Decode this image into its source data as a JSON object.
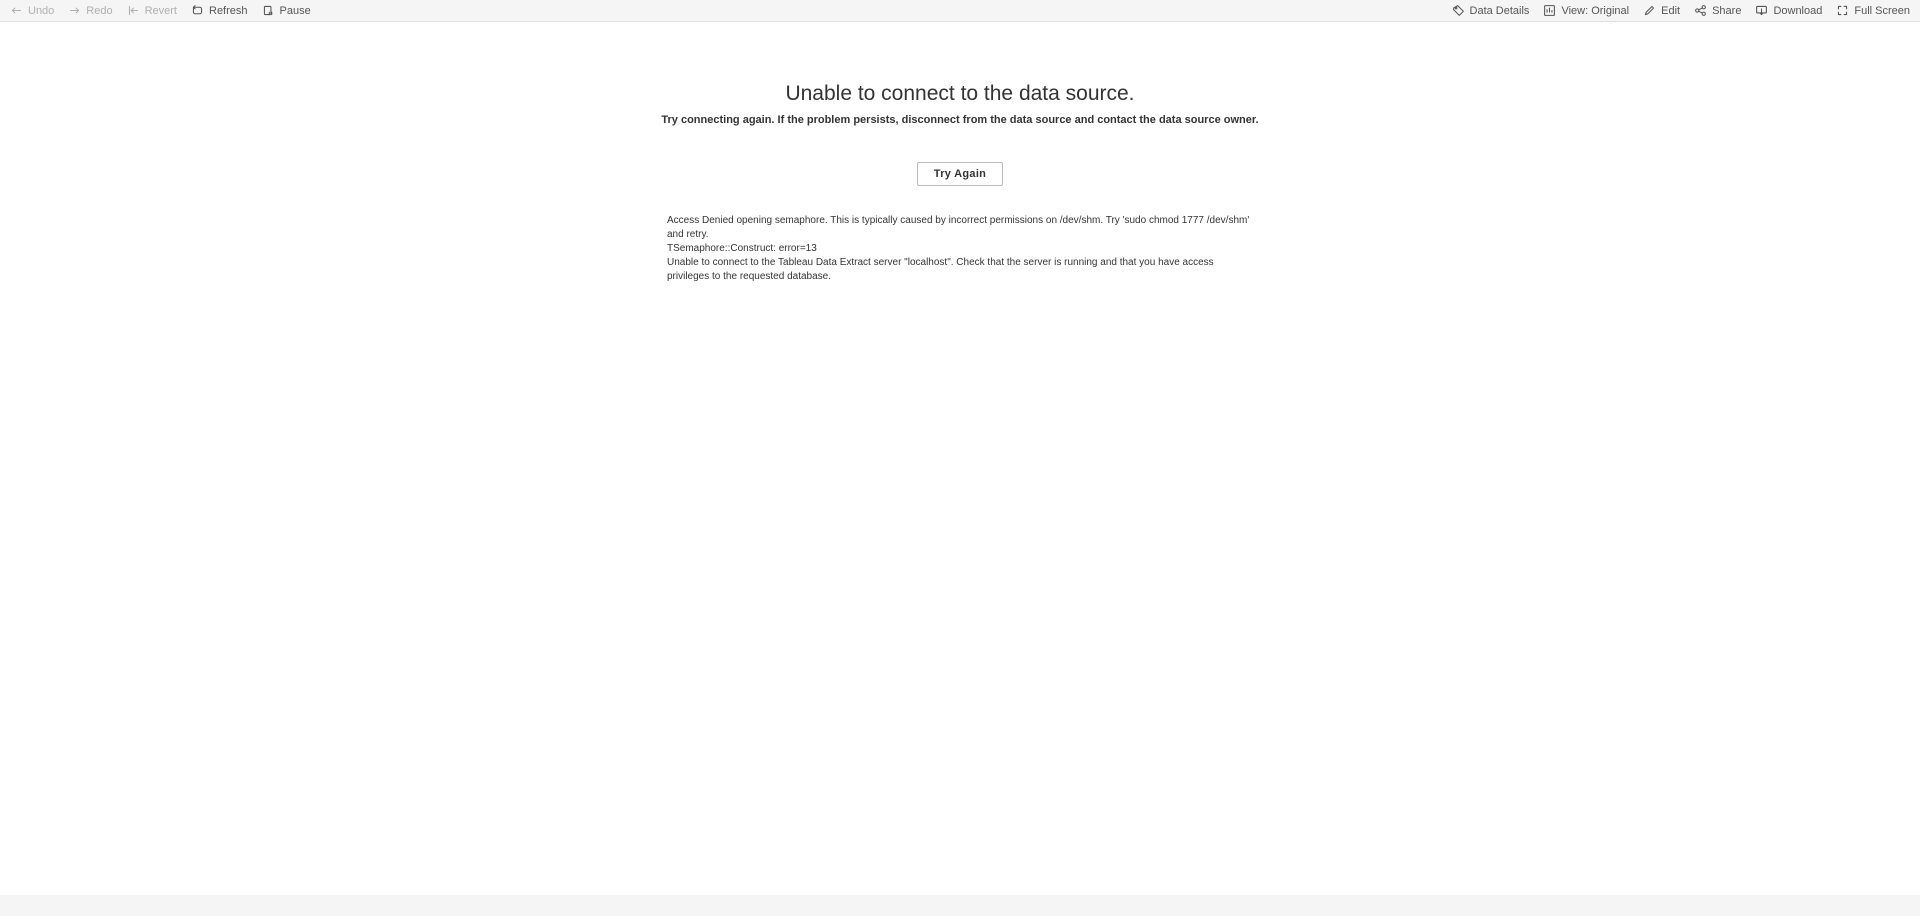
{
  "toolbar": {
    "left": {
      "undo": "Undo",
      "redo": "Redo",
      "revert": "Revert",
      "refresh": "Refresh",
      "pause": "Pause"
    },
    "right": {
      "data_details": "Data Details",
      "view": "View: Original",
      "edit": "Edit",
      "share": "Share",
      "download": "Download",
      "full_screen": "Full Screen"
    }
  },
  "error": {
    "title": "Unable to connect to the data source.",
    "subtitle": "Try connecting again. If the problem persists, disconnect from the data source and contact the data source owner.",
    "try_again": "Try Again",
    "details_line1": "Access Denied opening semaphore. This is typically caused by incorrect permissions on /dev/shm. Try 'sudo chmod 1777 /dev/shm' and retry.",
    "details_line2": "TSemaphore::Construct: error=13",
    "details_line3": "Unable to connect to the Tableau Data Extract server \"localhost\". Check that the server is running and that you have access privileges to the requested database."
  }
}
